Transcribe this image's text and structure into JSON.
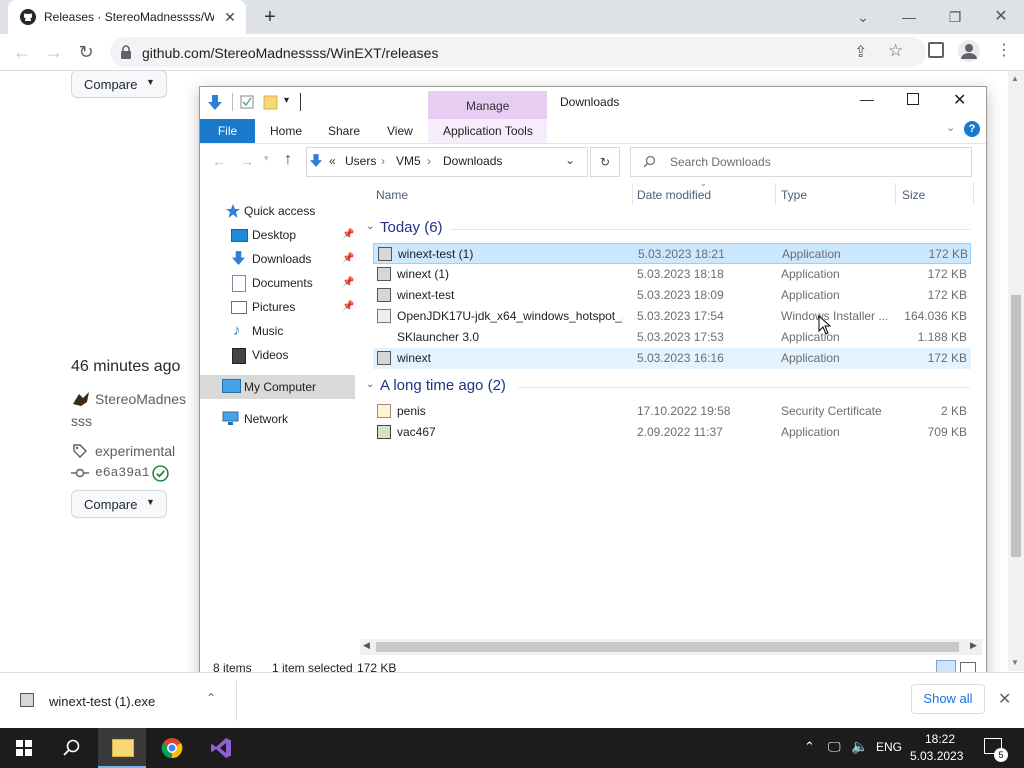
{
  "browser": {
    "tab_title": "Releases · StereoMadnessss/WinE",
    "tab_close": "✕",
    "new_tab": "+",
    "url": "github.com/StereoMadnessss/WinEXT/releases"
  },
  "page": {
    "compare_label": "Compare",
    "time_ago": "46 minutes ago",
    "author_line1": "StereoMadnes",
    "author_line2": "sss",
    "tag": "experimental",
    "commit": "e6a39a1"
  },
  "explorer": {
    "manage_tab": "Manage",
    "window_title": "Downloads",
    "ribbon": {
      "file": "File",
      "home": "Home",
      "share": "Share",
      "view": "View",
      "app_tools": "Application Tools"
    },
    "breadcrumb": {
      "prefix": "«",
      "items": [
        "Users",
        "VM5",
        "Downloads"
      ]
    },
    "search_placeholder": "Search Downloads",
    "columns": {
      "name": "Name",
      "date": "Date modified",
      "type": "Type",
      "size": "Size"
    },
    "sidebar": {
      "quick_access": "Quick access",
      "desktop": "Desktop",
      "downloads": "Downloads",
      "documents": "Documents",
      "pictures": "Pictures",
      "music": "Music",
      "videos": "Videos",
      "my_computer": "My Computer",
      "network": "Network"
    },
    "groups": {
      "today": "Today (6)",
      "long_ago": "A long time ago (2)"
    },
    "files_today": [
      {
        "name": "winext-test (1)",
        "date": "5.03.2023 18:21",
        "type": "Application",
        "size": "172 KB"
      },
      {
        "name": "winext (1)",
        "date": "5.03.2023 18:18",
        "type": "Application",
        "size": "172 KB"
      },
      {
        "name": "winext-test",
        "date": "5.03.2023 18:09",
        "type": "Application",
        "size": "172 KB"
      },
      {
        "name": "OpenJDK17U-jdk_x64_windows_hotspot_...",
        "date": "5.03.2023 17:54",
        "type": "Windows Installer ...",
        "size": "164.036 KB"
      },
      {
        "name": "SKlauncher 3.0",
        "date": "5.03.2023 17:53",
        "type": "Application",
        "size": "1.188 KB"
      },
      {
        "name": "winext",
        "date": "5.03.2023 16:16",
        "type": "Application",
        "size": "172 KB"
      }
    ],
    "files_old": [
      {
        "name": "penis",
        "date": "17.10.2022 19:58",
        "type": "Security Certificate",
        "size": "2 KB"
      },
      {
        "name": "vac467",
        "date": "2.09.2022 11:37",
        "type": "Application",
        "size": "709 KB"
      }
    ],
    "status": {
      "items": "8 items",
      "selected": "1 item selected",
      "size": "172 KB"
    }
  },
  "shelf": {
    "filename": "winext-test (1).exe",
    "show_all": "Show all"
  },
  "taskbar": {
    "lang": "ENG",
    "time": "18:22",
    "date": "5.03.2023",
    "notif_count": "5"
  },
  "colors": {
    "chrome_tabstrip": "#dee1e6",
    "file_tab": "#1979ca",
    "manage_tab": "#e8cdf3",
    "selection": "#cce8ff",
    "group_header": "#1e3287",
    "taskbar": "#1c1c1c"
  }
}
